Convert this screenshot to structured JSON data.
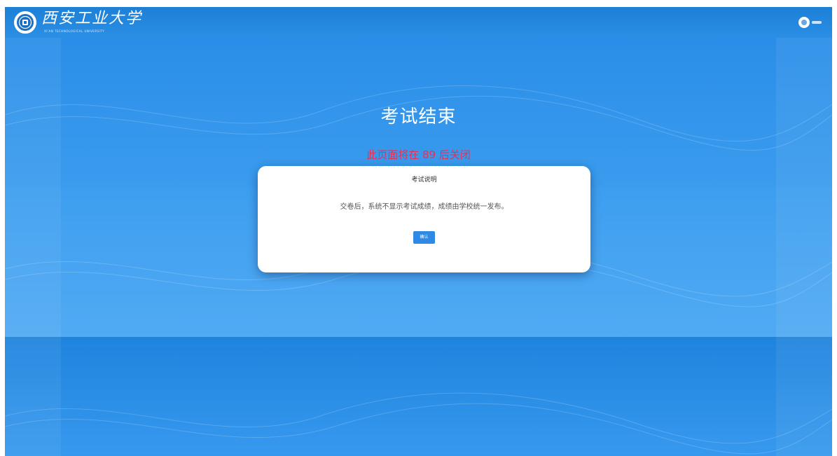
{
  "header": {
    "logo_name": "西安工业大学",
    "logo_subtitle": "XI'AN TECHNOLOGICAL UNIVERSITY",
    "user_icon": "user-avatar-icon"
  },
  "main": {
    "title": "考试结束",
    "countdown": "此页面将在 89 后关闭"
  },
  "dialog": {
    "title": "考试说明",
    "message": "交卷后，系统不显示考试成绩，成绩由学校统一发布。",
    "button_label": "确认"
  },
  "colors": {
    "header": "#1d7fd6",
    "background": "#3f9aec",
    "countdown": "#ec2e52",
    "button": "#2f8ae6"
  }
}
